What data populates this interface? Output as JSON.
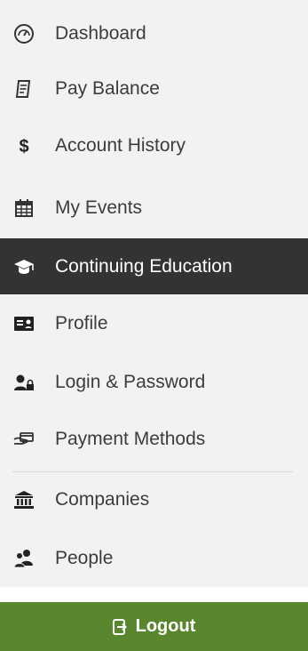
{
  "menu": {
    "items": [
      {
        "label": "Dashboard",
        "icon": "dashboard-gauge-icon"
      },
      {
        "label": "Pay Balance",
        "icon": "receipt-icon"
      },
      {
        "label": "Account History",
        "icon": "dollar-icon"
      },
      {
        "label": "My Events",
        "icon": "calendar-icon"
      },
      {
        "label": "Continuing Education",
        "icon": "graduation-cap-icon",
        "active": true
      },
      {
        "label": "Profile",
        "icon": "id-card-icon"
      },
      {
        "label": "Login & Password",
        "icon": "user-lock-icon"
      },
      {
        "label": "Payment Methods",
        "icon": "hand-payment-icon"
      },
      {
        "label": "Companies",
        "icon": "bank-icon"
      },
      {
        "label": "People",
        "icon": "people-icon"
      }
    ]
  },
  "logout": {
    "label": "Logout",
    "icon": "sign-out-icon"
  },
  "colors": {
    "active_bg": "#333333",
    "logout_bg": "#5a862e",
    "menu_bg": "#f2f2f2"
  }
}
